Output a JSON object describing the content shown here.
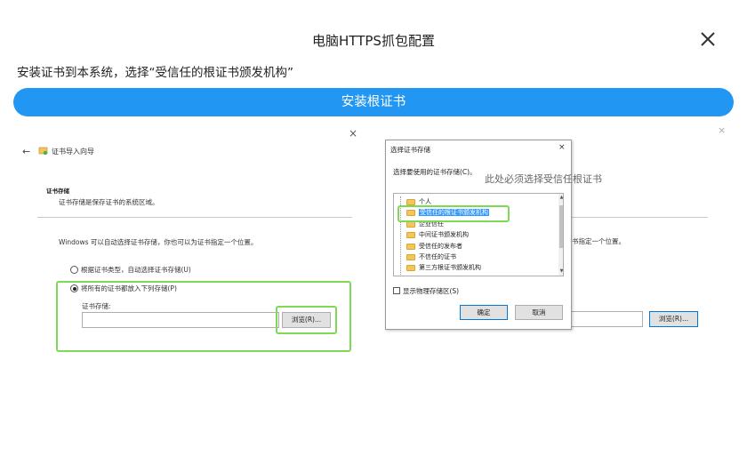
{
  "dialog": {
    "title": "电脑HTTPS抓包配置",
    "instruction": "安装证书到本系统，选择“受信任的根证书颁发机构”",
    "install_button": "安装根证书"
  },
  "wizard": {
    "back": "←",
    "title": "证书导入向导",
    "close": "×",
    "heading": "证书存储",
    "subheading": "证书存储是保存证书的系统区域。",
    "paragraph": "Windows 可以自动选择证书存储，你也可以为证书指定一个位置。",
    "radio_auto": "根据证书类型，自动选择证书存储(U)",
    "radio_manual": "将所有的证书都放入下列存储(P)",
    "store_label": "证书存储:",
    "browse_label": "浏览(R)..."
  },
  "background_wizard": {
    "close": "×",
    "partial_text": "书指定一个位置。",
    "browse_label": "浏览(R)..."
  },
  "store_dialog": {
    "title": "选择证书存储",
    "close": "×",
    "label": "选择要使用的证书存储(C)。",
    "items": [
      "个人",
      "受信任的根证书颁发机构",
      "企业信任",
      "中间证书颁发机构",
      "受信任的发布者",
      "不信任的证书",
      "第三方根证书颁发机构"
    ],
    "selected_index": 1,
    "show_physical": "显示物理存储区(S)",
    "ok": "确定",
    "cancel": "取消"
  },
  "note": "此处必须选择受信任根证书",
  "colors": {
    "accent": "#2196f3",
    "highlight_border": "#7ed957",
    "selection": "#3399ff"
  }
}
